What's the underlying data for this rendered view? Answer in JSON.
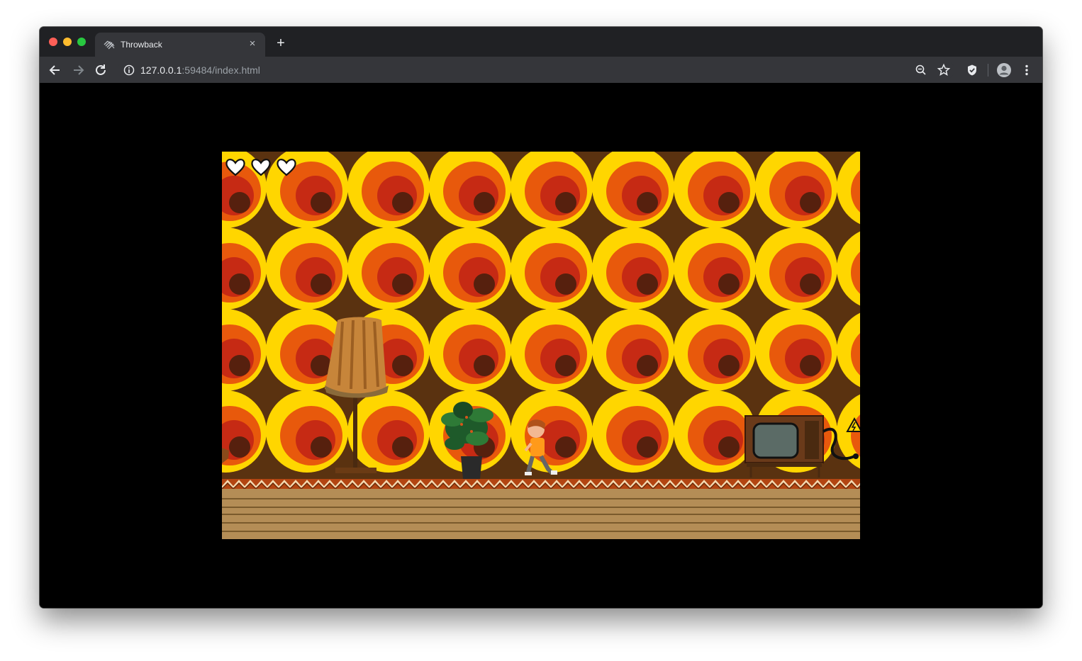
{
  "browser": {
    "tab_title": "Throwback",
    "favicon": "throwback-logo-icon",
    "new_tab_symbol": "+",
    "close_symbol": "×",
    "url_host": "127.0.0.1",
    "url_path": ":59484/index.html"
  },
  "toolbar_icons": [
    "back-icon",
    "forward-icon",
    "reload-icon",
    "info-icon",
    "zoom-out-icon",
    "bookmark-star-icon",
    "shield-extension-icon",
    "profile-avatar-icon",
    "menu-dots-icon"
  ],
  "game": {
    "lives": 3,
    "hearts": [
      "heart-icon",
      "heart-icon",
      "heart-icon"
    ],
    "scene": {
      "wallpaper": "retro-circles",
      "objects": [
        "floor-lamp",
        "potted-plant",
        "player-boy",
        "vintage-tv",
        "electric-plug",
        "warning-sign"
      ]
    },
    "colors": {
      "wall_brown": "#5a3210",
      "circle_yellow": "#ffd600",
      "circle_orange": "#e8590c",
      "circle_red": "#c62a14",
      "circle_dark": "#56200e",
      "floor": "#b48d56",
      "floor_lines": "#7a5a2c"
    }
  }
}
